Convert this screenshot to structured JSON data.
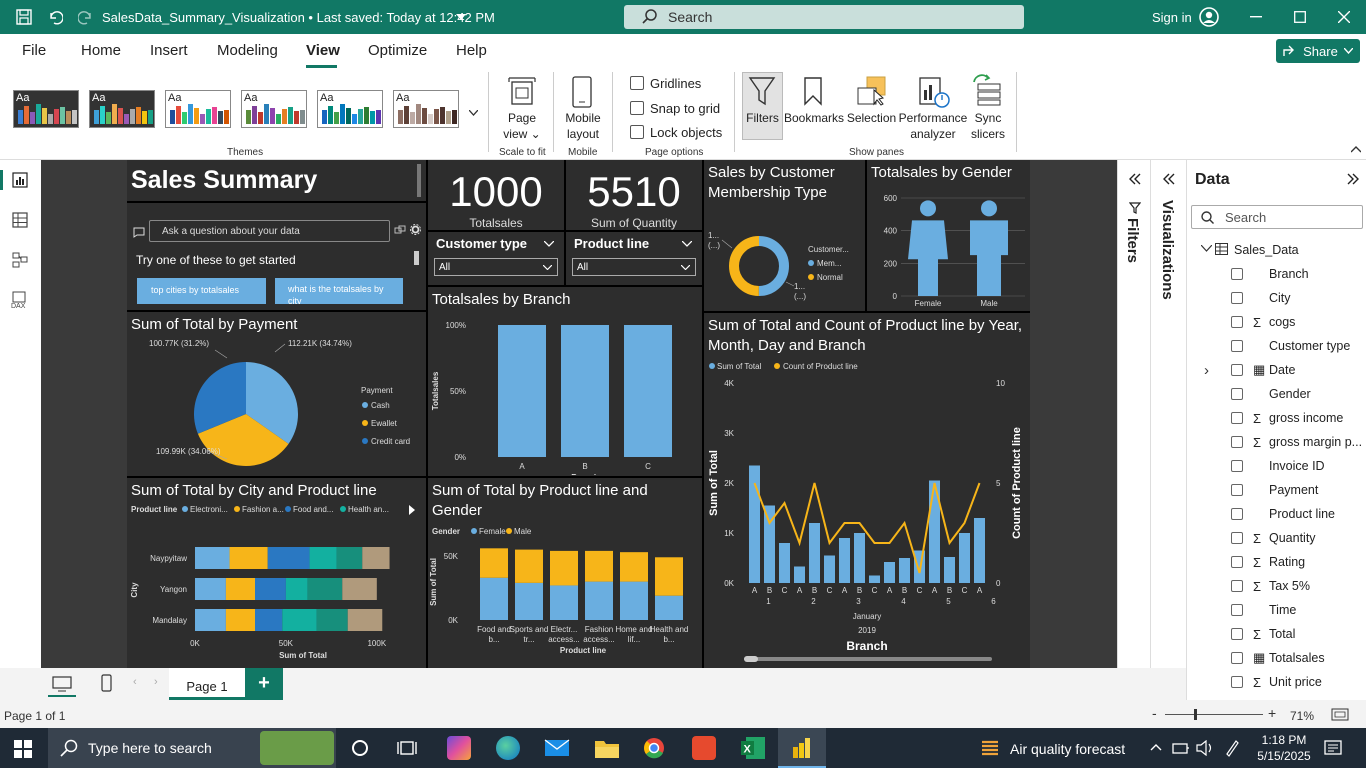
{
  "titlebar": {
    "title": "SalesData_Summary_Visualization • Last saved: Today at 12:42 PM",
    "search": "Search",
    "signin": "Sign in"
  },
  "menu": {
    "items": [
      "File",
      "Home",
      "Insert",
      "Modeling",
      "View",
      "Optimize",
      "Help"
    ],
    "active": "View",
    "share": "Share"
  },
  "ribbon": {
    "themes_label": "Themes",
    "page_view": "Page view",
    "scale_label": "Scale to fit",
    "mobile_layout": "Mobile layout",
    "mobile_label": "Mobile",
    "gridlines": "Gridlines",
    "snap": "Snap to grid",
    "lock": "Lock objects",
    "page_options_label": "Page options",
    "filters": "Filters",
    "bookmarks": "Bookmarks",
    "selection": "Selection",
    "performance": "Performance analyzer",
    "sync": "Sync slicers",
    "show_panes_label": "Show panes",
    "theme_sample": "Aa"
  },
  "report": {
    "title": "Sales Summary",
    "qa_placeholder": "Ask a question about your data",
    "qa_prompt": "Try one of these to get started",
    "qa_suggestions": [
      "top cities by totalsales",
      "what is the totalsales by city"
    ],
    "card1_value": "1000",
    "card1_label": "Totalsales",
    "card2_value": "5510",
    "card2_label": "Sum of Quantity",
    "slicer1_title": "Customer type",
    "slicer1_value": "All",
    "slicer2_title": "Product line",
    "slicer2_value": "All",
    "membership_title": "Sales by Customer Membership Type",
    "gender_title": "Totalsales by Gender",
    "branch_title": "Totalsales by Branch",
    "payment_title": "Sum of Total by Payment",
    "combo_title": "Sum of Total and Count of Product line by Year, Month, Day and Branch",
    "city_title": "Sum of Total by City and Product line",
    "prod_gender_title": "Sum of Total by Product line and Gender"
  },
  "chart_data": [
    {
      "type": "pie",
      "title": "Sales by Customer Membership Type",
      "legend_title": "Customer...",
      "labels": [
        "Mem...",
        "Normal"
      ],
      "values": [
        50.1,
        49.9
      ],
      "colors": [
        "#6aaee0",
        "#f7b519"
      ],
      "data_labels": [
        "1...",
        "(...)",
        "1...",
        "(...)"
      ]
    },
    {
      "type": "bar",
      "title": "Totalsales by Gender",
      "categories": [
        "Female",
        "Male"
      ],
      "values": [
        500,
        500
      ],
      "ylim": [
        0,
        600
      ],
      "yticks": [
        "600",
        "400",
        "200",
        "0"
      ]
    },
    {
      "type": "bar",
      "title": "Totalsales by Branch",
      "categories": [
        "A",
        "B",
        "C"
      ],
      "values": [
        100,
        100,
        100
      ],
      "ylabel": "Totalsales",
      "xlabel": "Branch",
      "yticks": [
        "100%",
        "50%",
        "0%"
      ]
    },
    {
      "type": "pie",
      "title": "Sum of Total by Payment",
      "legend_title": "Payment",
      "labels": [
        "Cash",
        "Ewallet",
        "Credit card"
      ],
      "values": [
        112.21,
        109.99,
        100.77
      ],
      "data_labels": [
        "112.21K (34.74%)",
        "109.99K (34.06%)",
        "100.77K (31.2%)"
      ],
      "colors": [
        "#6aaee0",
        "#f7b519",
        "#2a78c2"
      ]
    },
    {
      "type": "bar",
      "title": "Sum of Total and Count of Product line by Year, Month, Day and Branch",
      "legend": [
        "Sum of Total",
        "Count of Product line"
      ],
      "categories": [
        "A",
        "B",
        "C",
        "A",
        "B",
        "C",
        "A",
        "B",
        "C",
        "A",
        "B",
        "C",
        "A",
        "B",
        "C",
        "A"
      ],
      "day_labels": [
        "1",
        "2",
        "3",
        "4",
        "5",
        "6"
      ],
      "month": "January",
      "year": "2019",
      "xlabel": "Branch",
      "ylabel": "Sum of Total",
      "y2label": "Count of Product line",
      "values": [
        2350,
        1550,
        800,
        330,
        1200,
        550,
        900,
        1000,
        150,
        420,
        500,
        650,
        2050,
        520,
        1000,
        1300
      ],
      "line_values": [
        5,
        3,
        4,
        2,
        5,
        2,
        3,
        3,
        2,
        2,
        3,
        0.5,
        5,
        2,
        3,
        5
      ],
      "ylim": [
        0,
        4000
      ],
      "y2lim": [
        0,
        10
      ],
      "yticks": [
        "4K",
        "3K",
        "2K",
        "1K",
        "0K"
      ],
      "y2ticks": [
        "10",
        "5",
        "0"
      ]
    },
    {
      "type": "bar",
      "title": "Sum of Total by City and Product line",
      "legend_title": "Product line",
      "legend": [
        "Electroni...",
        "Fashion a...",
        "Food and...",
        "Health an..."
      ],
      "categories": [
        "Naypyitaw",
        "Yangon",
        "Mandalay"
      ],
      "series": [
        {
          "name": "Electronic accessories",
          "values": [
            19,
            17,
            17
          ]
        },
        {
          "name": "Fashion accessories",
          "values": [
            21,
            16,
            16
          ]
        },
        {
          "name": "Food and beverages",
          "values": [
            23,
            17,
            15
          ]
        },
        {
          "name": "Health and beauty",
          "values": [
            15,
            12,
            19
          ]
        },
        {
          "name": "Home and lifestyle",
          "values": [
            14,
            19,
            17
          ]
        },
        {
          "name": "Sports and travel",
          "values": [
            15,
            19,
            19
          ]
        }
      ],
      "xticks": [
        "0K",
        "50K",
        "100K"
      ],
      "xlabel": "Sum of Total",
      "ylabel": "City"
    },
    {
      "type": "bar",
      "title": "Sum of Total by Product line and Gender",
      "legend_title": "Gender",
      "legend": [
        "Female",
        "Male"
      ],
      "categories": [
        "Food and b...",
        "Sports and tr...",
        "Electr... access...",
        "Fashion access...",
        "Home and lif...",
        "Health and b..."
      ],
      "series": [
        {
          "name": "Female",
          "values": [
            33,
            29,
            27,
            30,
            30,
            19
          ]
        },
        {
          "name": "Male",
          "values": [
            23,
            26,
            27,
            24,
            23,
            30
          ]
        }
      ],
      "yticks": [
        "50K",
        "0K"
      ],
      "ylabel": "Sum of Total",
      "xlabel": "Product line"
    }
  ],
  "panes": {
    "filters": "Filters",
    "visualizations": "Visualizations",
    "data_title": "Data",
    "data_search": "Search",
    "table": "Sales_Data",
    "fields": [
      {
        "name": "Branch",
        "sigma": false
      },
      {
        "name": "City",
        "sigma": false
      },
      {
        "name": "cogs",
        "sigma": true
      },
      {
        "name": "Customer type",
        "sigma": false
      },
      {
        "name": "Date",
        "sigma": false,
        "date": true
      },
      {
        "name": "Gender",
        "sigma": false
      },
      {
        "name": "gross income",
        "sigma": true
      },
      {
        "name": "gross margin p...",
        "sigma": true
      },
      {
        "name": "Invoice ID",
        "sigma": false
      },
      {
        "name": "Payment",
        "sigma": false
      },
      {
        "name": "Product line",
        "sigma": false
      },
      {
        "name": "Quantity",
        "sigma": true
      },
      {
        "name": "Rating",
        "sigma": true
      },
      {
        "name": "Tax 5%",
        "sigma": true
      },
      {
        "name": "Time",
        "sigma": false
      },
      {
        "name": "Total",
        "sigma": true
      },
      {
        "name": "Totalsales",
        "sigma": false,
        "table": true
      },
      {
        "name": "Unit price",
        "sigma": true
      }
    ]
  },
  "pages": {
    "tab": "Page 1",
    "status": "Page 1 of 1",
    "zoom": "71%"
  },
  "taskbar": {
    "search": "Type here to search",
    "weather": "Air quality forecast",
    "time": "1:18 PM",
    "date": "5/15/2025"
  },
  "colors": {
    "brand": "#117865",
    "blue": "#6aaee0",
    "yellow": "#f7b519",
    "darkblue": "#2a78c2",
    "teal": "#13b0a0",
    "darkteal": "#178f7c",
    "tan": "#b09a7c"
  }
}
